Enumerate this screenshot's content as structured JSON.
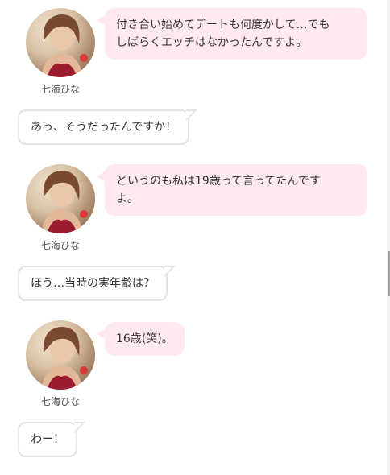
{
  "speaker": {
    "name": "七海ひな"
  },
  "messages": [
    {
      "side": "speaker",
      "text_line1": "付き合い始めてデートも何度かして…でも",
      "text_line2": "しばらくエッチはなかったんですよ。"
    },
    {
      "side": "interviewer",
      "text": "あっ、そうだったんですか！"
    },
    {
      "side": "speaker",
      "text_line1": "というのも私は19歳って言ってたんです",
      "text_line2": "よ。"
    },
    {
      "side": "interviewer",
      "text": "ほう…当時の実年齢は？"
    },
    {
      "side": "speaker",
      "text_line1": "16歳(笑)。"
    },
    {
      "side": "interviewer",
      "text": "わー！"
    }
  ],
  "colors": {
    "speaker_bubble": "#ffe9f0",
    "interviewer_border": "#e3e3e3"
  }
}
